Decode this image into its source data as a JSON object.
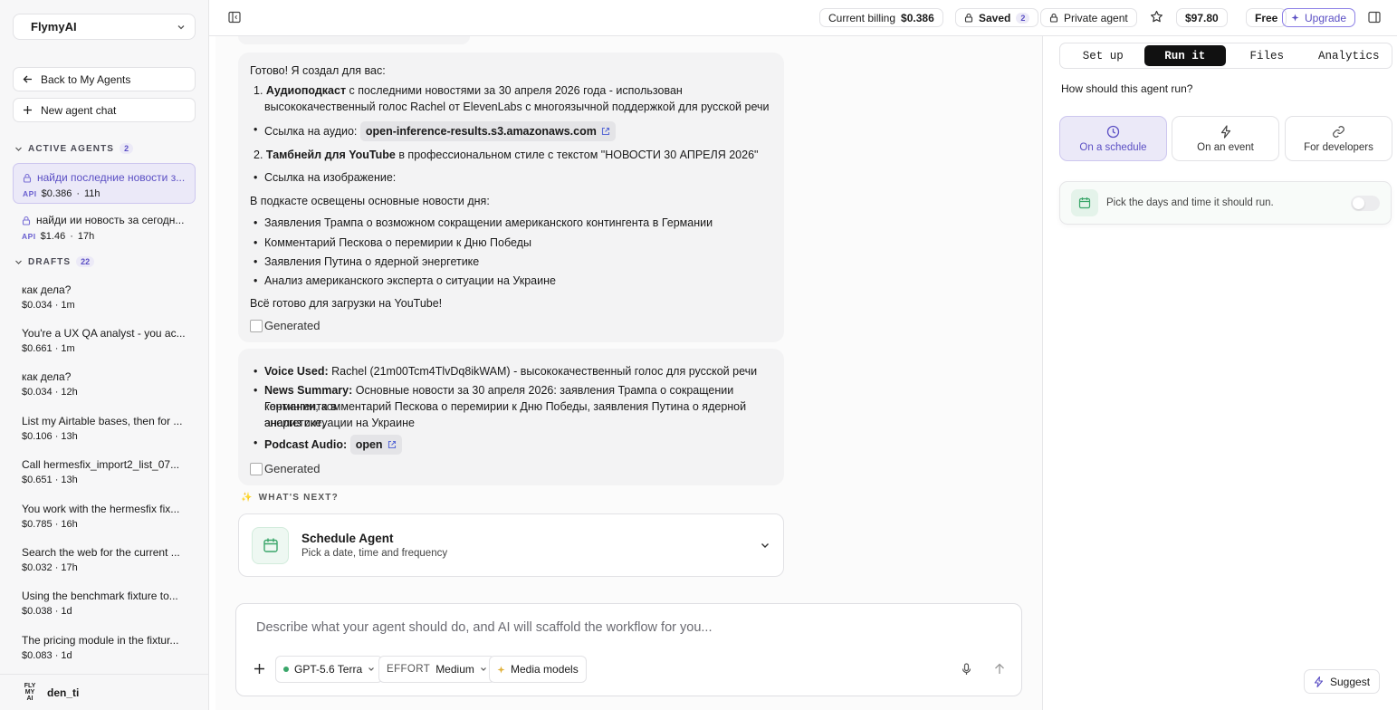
{
  "sidebar": {
    "workspace": "FlymyAI",
    "back_label": "Back to My Agents",
    "new_chat_label": "New agent chat",
    "active_section": "ACTIVE AGENTS",
    "active_count": "2",
    "active_agents": [
      {
        "title": "найди последние новости з...",
        "badge": "API",
        "cost": "$0.386",
        "age": "11h"
      },
      {
        "title": "найди ии новость за сегодн...",
        "badge": "API",
        "cost": "$1.46",
        "age": "17h"
      }
    ],
    "drafts_section": "DRAFTS",
    "drafts_count": "22",
    "drafts": [
      {
        "title": "как дела?",
        "meta": "$0.034 · 1m"
      },
      {
        "title": "You're a UX QA analyst - you ac...",
        "meta": "$0.661 · 1m"
      },
      {
        "title": "как дела?",
        "meta": "$0.034 · 12h"
      },
      {
        "title": "List my Airtable bases, then for ...",
        "meta": "$0.106 · 13h"
      },
      {
        "title": "Call hermesfix_import2_list_07...",
        "meta": "$0.651 · 13h"
      },
      {
        "title": "You work with the hermesfix fix...",
        "meta": "$0.785 · 16h"
      },
      {
        "title": "Search the web for the current ...",
        "meta": "$0.032 · 17h"
      },
      {
        "title": "Using the benchmark fixture to...",
        "meta": "$0.038 · 1d"
      },
      {
        "title": "The pricing module in the fixtur...",
        "meta": "$0.083 · 1d"
      }
    ],
    "user": {
      "name": "den_ti",
      "avatar_text": "FLY MY AI"
    }
  },
  "topbar": {
    "billing_label": "Current billing",
    "billing_value": "$0.386",
    "saved_label": "Saved",
    "saved_count": "2",
    "private_label": "Private agent",
    "balance": "$97.80",
    "plan": "Free",
    "upgrade_label": "Upgrade"
  },
  "chat": {
    "msg1": {
      "intro": "Готово! Я создал для вас:",
      "item1_bold": "Аудиоподкаст",
      "item1_line1": " с последними новостями за 30 апреля 2026 года - использован",
      "item1_line2": "высококачественный голос Rachel от ElevenLabs с многоязычной поддержкой для русской речи",
      "audio_label": "Ссылка на аудио:",
      "audio_link": "open-inference-results.s3.amazonaws.com",
      "item2_bold": "Тамбнейл для YouTube",
      "item2_rest": " в профессиональном стиле с текстом \"НОВОСТИ 30 АПРЕЛЯ 2026\"",
      "image_label": "Ссылка на изображение:",
      "summary_intro": "В подкасте освещены основные новости дня:",
      "bullets": [
        "Заявления Трампа о возможном сокращении американского контингента в Германии",
        "Комментарий Пескова о перемирии к Дню Победы",
        "Заявления Путина о ядерной энергетике",
        "Анализ американского эксперта о ситуации на Украине"
      ],
      "outro": "Всё готово для загрузки на YouTube!",
      "img_alt": "Generated"
    },
    "msg2": {
      "voice_bold": "Voice Used:",
      "voice_text": " Rachel (21m00Tcm4TlvDq8ikWAM) - высококачественный голос для русской речи",
      "news_bold": "News Summary:",
      "news_line1": " Основные новости за 30 апреля 2026: заявления Трампа о сокращении контингента в",
      "news_line2": "Германии, комментарий Пескова о перемирии к Дню Победы, заявления Путина о ядерной энергетике,",
      "news_line3": "анализ ситуации на Украине",
      "podcast_bold": "Podcast Audio:",
      "podcast_link": "open",
      "img_alt": "Generated"
    },
    "whats_next": "WHAT'S NEXT?",
    "schedule_title": "Schedule Agent",
    "schedule_sub": "Pick a date, time and frequency"
  },
  "composer": {
    "placeholder": "Describe what your agent should do, and AI will scaffold the workflow for you...",
    "model": "GPT-5.6 Terra",
    "effort_label": "EFFORT",
    "effort_value": "Medium",
    "media_label": "Media models"
  },
  "right_panel": {
    "tabs": [
      "Set up",
      "Run it",
      "Files",
      "Analytics"
    ],
    "question": "How should this agent run?",
    "options": [
      "On a schedule",
      "On an event",
      "For developers"
    ],
    "pick_text": "Pick the days and time it should run.",
    "suggest_label": "Suggest"
  },
  "colors": {
    "accent": "#5b4fc4",
    "green": "#3aa66a"
  }
}
